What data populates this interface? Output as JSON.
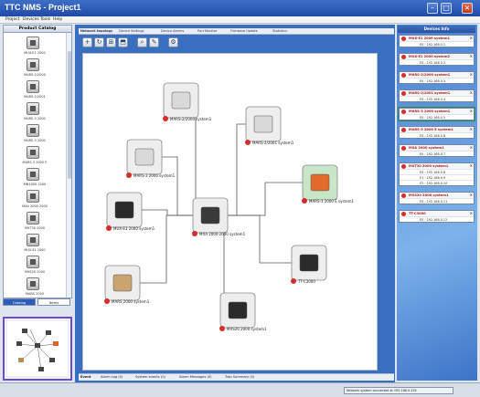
{
  "window": {
    "title": "TTC NMS - Project1",
    "minimize": "–",
    "maximize": "□",
    "close": "×"
  },
  "menu": [
    "Project",
    "Devices",
    "Tools",
    "Help"
  ],
  "catalog": {
    "header": "Product Catalog",
    "items": [
      "MUX-E1 2000",
      "MARS-2/2000",
      "MARS-2/2001",
      "MARS-3 2000",
      "MARS-3 2000",
      "MARS-3 2000 E",
      "MN1000 2000",
      "MXA 2000 2000",
      "MXT30 2000",
      "MUX-EL 2000",
      "MXS20 2000",
      "MARS 2000"
    ],
    "tabs": [
      "Catalog",
      "Items"
    ]
  },
  "tabs": [
    "Network topology",
    "Device Settings",
    "Device Alarms",
    "Port Monitor",
    "Firmware Update",
    "Statistics"
  ],
  "toolbar": [
    "+",
    "↻",
    "⊞",
    "⬒",
    "⌕",
    "✎",
    "⚙"
  ],
  "bottom_tabs": [
    "Event",
    "Alarm Log (0)",
    "System events (0)",
    "Alarm Messages (0)",
    "Trap Summary (0)"
  ],
  "nodes": [
    {
      "label": "MARS-2/2000 system1",
      "kind": "gray"
    },
    {
      "label": "MARS-2/2001 system1",
      "kind": "gray"
    },
    {
      "label": "MARS-3 2000 system1",
      "kind": "gray"
    },
    {
      "label": "MARS-3 2000 E system1",
      "kind": "orange"
    },
    {
      "label": "MUX-E1 2000 system1",
      "kind": "black"
    },
    {
      "label": "MXA 2000 2000 system1",
      "kind": "dark"
    },
    {
      "label": "TT-C3000",
      "kind": "black"
    },
    {
      "label": "MARS 2000 system1",
      "kind": "tan"
    },
    {
      "label": "MXS20 2000 system1",
      "kind": "black"
    }
  ],
  "right_panel": {
    "header": "Devices Info",
    "devices": [
      {
        "title": "MUX-E1 2000 system1",
        "ports": [
          "E0  : 192.168.0.1"
        ]
      },
      {
        "title": "MUX-E1 2000 system2",
        "ports": [
          "E0  : 192.168.0.2"
        ]
      },
      {
        "title": "MARS-2/2000 system1",
        "ports": [
          "E0  : 192.168.0.3"
        ]
      },
      {
        "title": "MARS-2/2001 system1",
        "ports": [
          "E0  : 192.168.0.4"
        ]
      },
      {
        "title": "MARS-3 2000 system1",
        "ports": [
          "E0  : 192.168.0.5"
        ],
        "selected": true
      },
      {
        "title": "MARS-3 2000 E system1",
        "ports": [
          "E0  : 192.168.0.6"
        ]
      },
      {
        "title": "MXA 2000 system1",
        "ports": [
          "E0  : 192.168.0.7"
        ]
      },
      {
        "title": "MXT30 2000 system1",
        "ports": [
          "E0  : 192.168.0.8",
          "E1  : 192.168.0.9",
          "E2  : 192.168.0.10"
        ]
      },
      {
        "title": "MXS20 2000 system1",
        "ports": [
          "E0  : 192.168.0.11"
        ]
      },
      {
        "title": "TT-C3000",
        "ports": [
          "E0  : 192.168.0.12"
        ]
      }
    ]
  },
  "status": {
    "tray": "Network system connected at 192.168.0.254"
  },
  "colors": {
    "accent": "#2c5bb8",
    "alarm": "#d52b2b",
    "panel": "#4a7ed2"
  }
}
